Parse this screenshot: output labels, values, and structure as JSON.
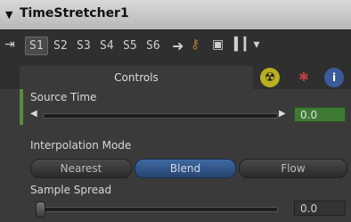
{
  "node": {
    "title": "TimeStretcher1"
  },
  "toolbar": {
    "slots": [
      "S1",
      "S2",
      "S3",
      "S4",
      "S5",
      "S6"
    ],
    "active_slot": "S1"
  },
  "tabs": {
    "controls_label": "Controls"
  },
  "source_time": {
    "label": "Source Time",
    "value": "0.0"
  },
  "interpolation": {
    "label": "Interpolation Mode",
    "options": [
      "Nearest",
      "Blend",
      "Flow"
    ],
    "selected": "Blend"
  },
  "sample_spread": {
    "label": "Sample Spread",
    "value": "0.0"
  },
  "colors": {
    "selected_button": "#3f6aa3",
    "value_box_green": "#3f7a34",
    "title_bar": "#c8c8c8"
  },
  "icons": [
    "collapse-arrow-icon",
    "pin-icon",
    "arrow-right-icon",
    "key-icon",
    "save-icon",
    "layout-icon",
    "radioactive-icon",
    "gear-icon",
    "info-icon"
  ]
}
